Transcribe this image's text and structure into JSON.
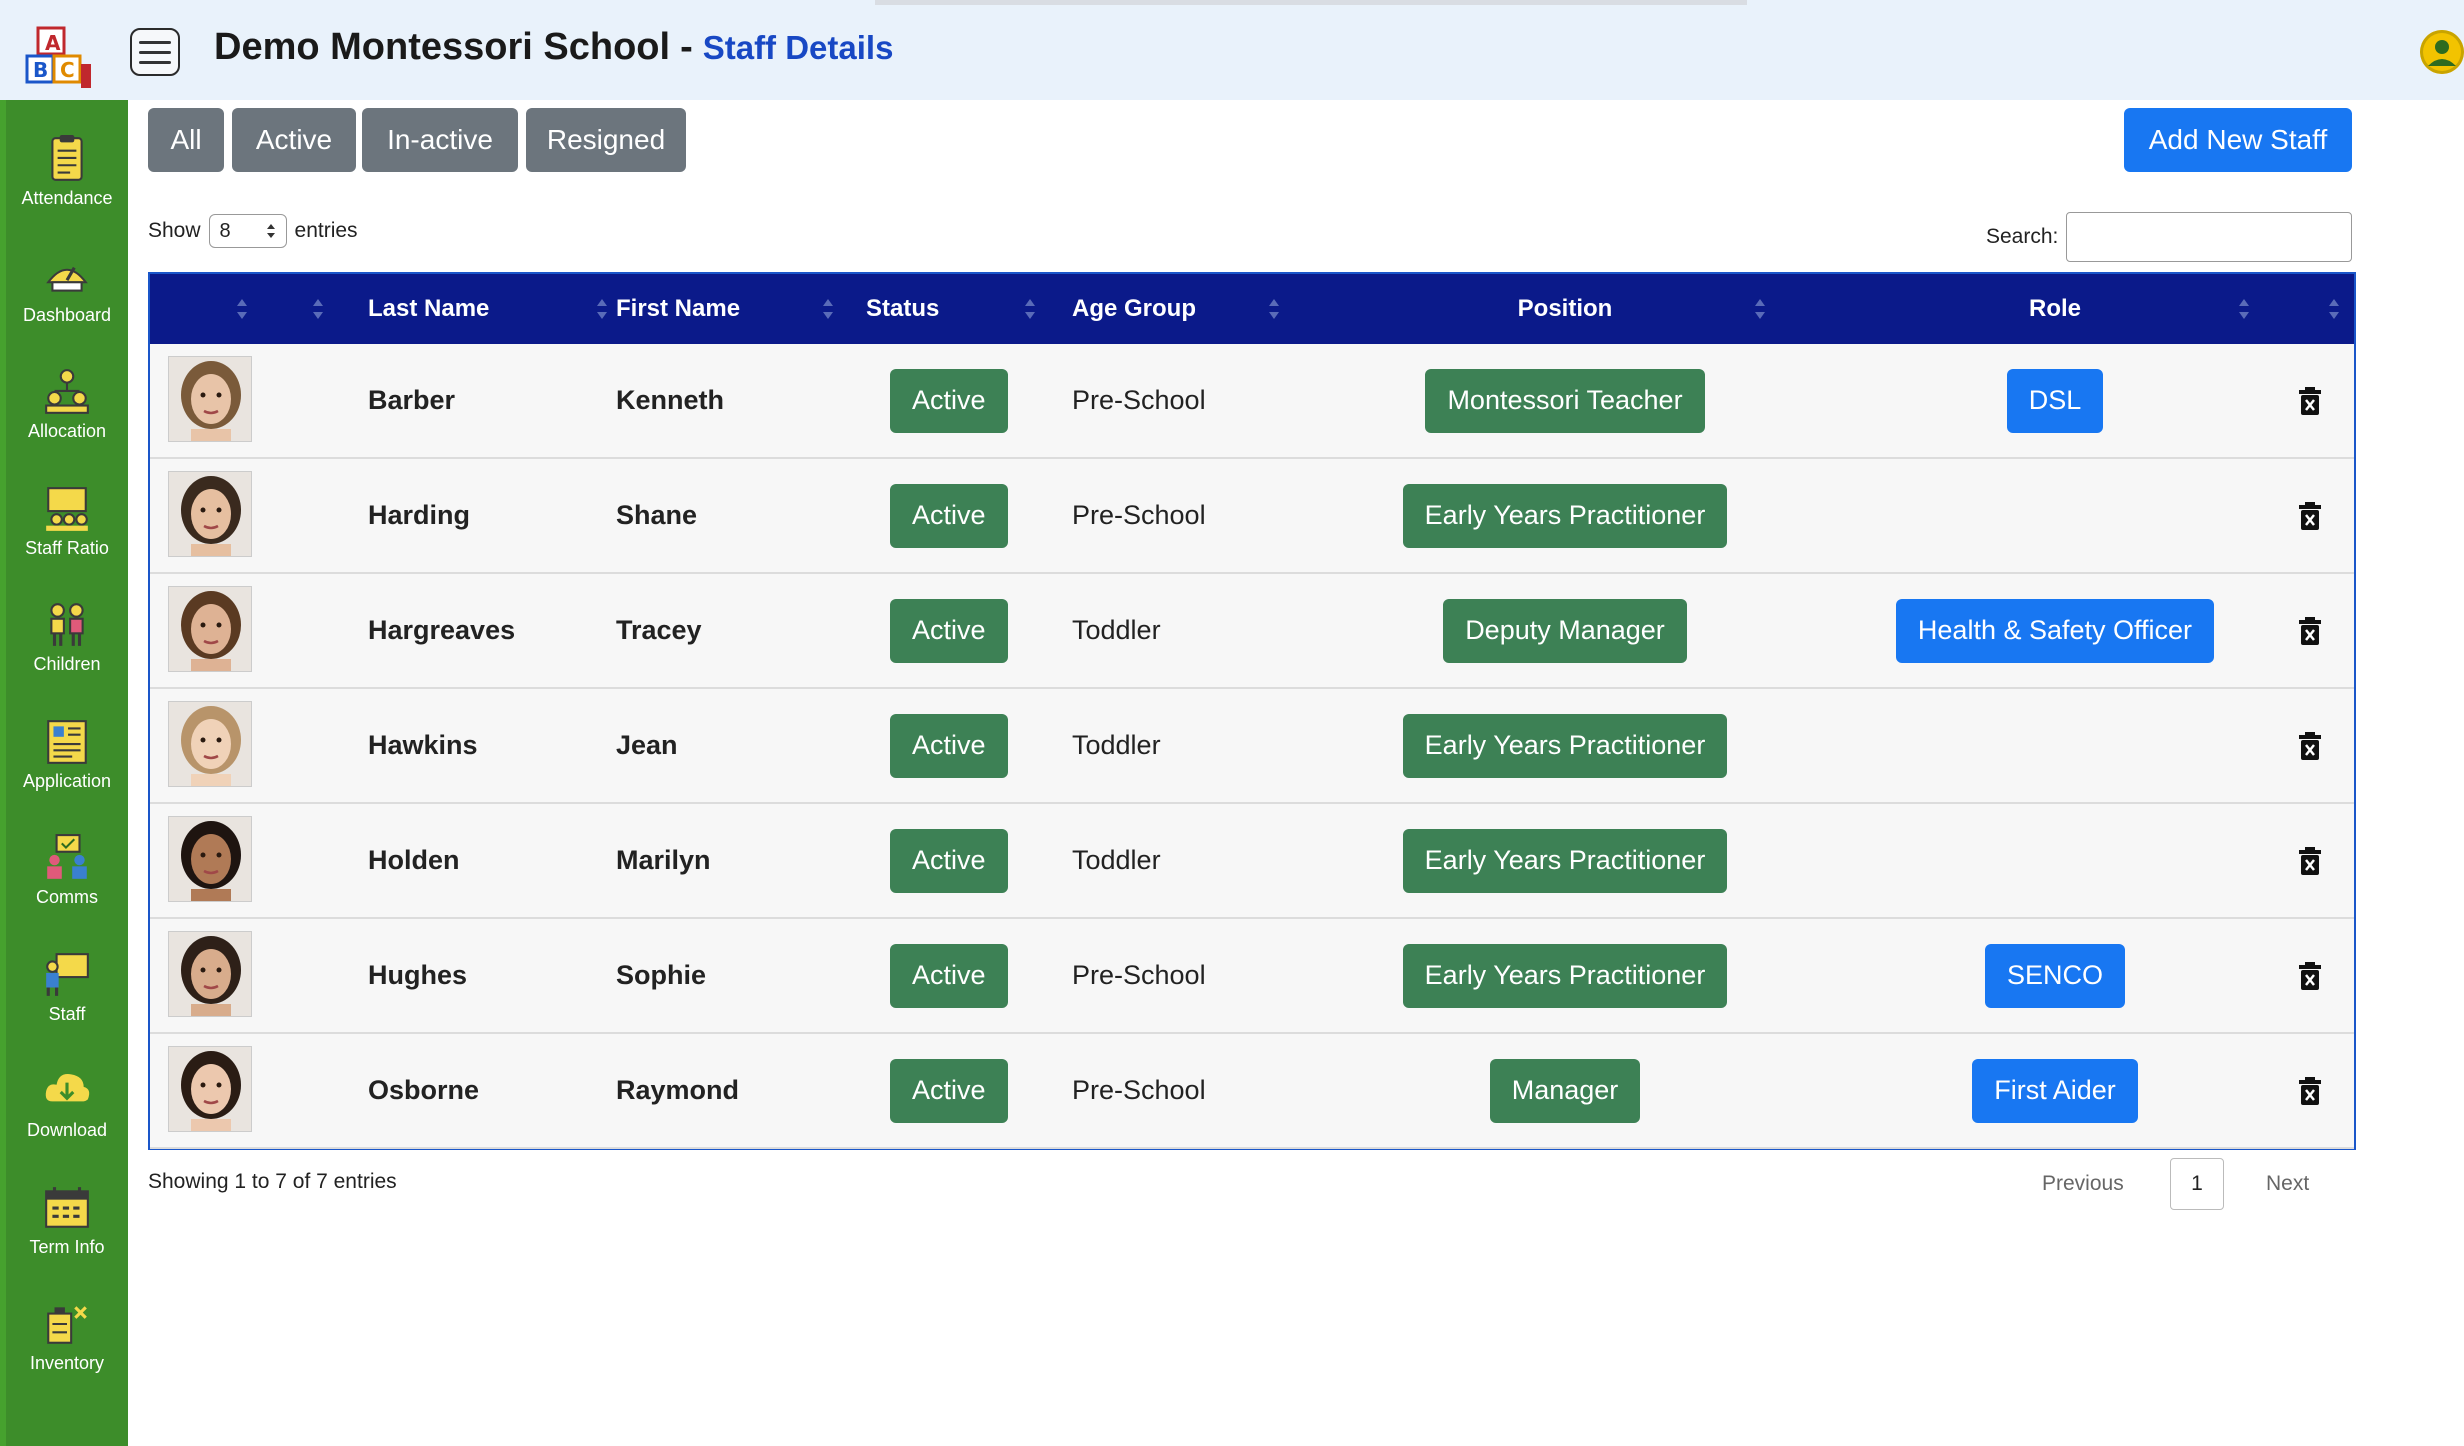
{
  "header": {
    "title": "Demo Montessori School",
    "separator": "-",
    "subtitle": "Staff Details"
  },
  "sidebar": {
    "items": [
      {
        "label": "Attendance",
        "icon": "attendance-icon"
      },
      {
        "label": "Dashboard",
        "icon": "dashboard-icon"
      },
      {
        "label": "Allocation",
        "icon": "allocation-icon"
      },
      {
        "label": "Staff Ratio",
        "icon": "staff-ratio-icon"
      },
      {
        "label": "Children",
        "icon": "children-icon"
      },
      {
        "label": "Application",
        "icon": "application-icon"
      },
      {
        "label": "Comms",
        "icon": "comms-icon"
      },
      {
        "label": "Staff",
        "icon": "staff-icon"
      },
      {
        "label": "Download",
        "icon": "download-icon"
      },
      {
        "label": "Term Info",
        "icon": "term-info-icon"
      },
      {
        "label": "Inventory",
        "icon": "inventory-icon"
      }
    ]
  },
  "filters": [
    "All",
    "Active",
    "In-active",
    "Resigned"
  ],
  "add_button": "Add New Staff",
  "show": {
    "label_before": "Show",
    "value": "8",
    "label_after": "entries"
  },
  "search": {
    "label": "Search:",
    "value": ""
  },
  "table": {
    "headers": [
      "Last Name",
      "First Name",
      "Status",
      "Age Group",
      "Position",
      "Role"
    ],
    "rows": [
      {
        "last": "Barber",
        "first": "Kenneth",
        "status": "Active",
        "age": "Pre-School",
        "position": "Montessori Teacher",
        "role": "DSL"
      },
      {
        "last": "Harding",
        "first": "Shane",
        "status": "Active",
        "age": "Pre-School",
        "position": "Early Years Practitioner",
        "role": ""
      },
      {
        "last": "Hargreaves",
        "first": "Tracey",
        "status": "Active",
        "age": "Toddler",
        "position": "Deputy Manager",
        "role": "Health & Safety Officer"
      },
      {
        "last": "Hawkins",
        "first": "Jean",
        "status": "Active",
        "age": "Toddler",
        "position": "Early Years Practitioner",
        "role": ""
      },
      {
        "last": "Holden",
        "first": "Marilyn",
        "status": "Active",
        "age": "Toddler",
        "position": "Early Years Practitioner",
        "role": ""
      },
      {
        "last": "Hughes",
        "first": "Sophie",
        "status": "Active",
        "age": "Pre-School",
        "position": "Early Years Practitioner",
        "role": "SENCO"
      },
      {
        "last": "Osborne",
        "first": "Raymond",
        "status": "Active",
        "age": "Pre-School",
        "position": "Manager",
        "role": "First Aider"
      }
    ]
  },
  "footer": {
    "summary": "Showing 1 to 7 of 7 entries",
    "previous": "Previous",
    "page": "1",
    "next": "Next"
  },
  "colors": {
    "sidebar": "#3d8d2a",
    "table_header": "#0b1a8a",
    "status_badge": "#3d8155",
    "role_badge": "#1877f2",
    "subtitle": "#1848c4"
  }
}
